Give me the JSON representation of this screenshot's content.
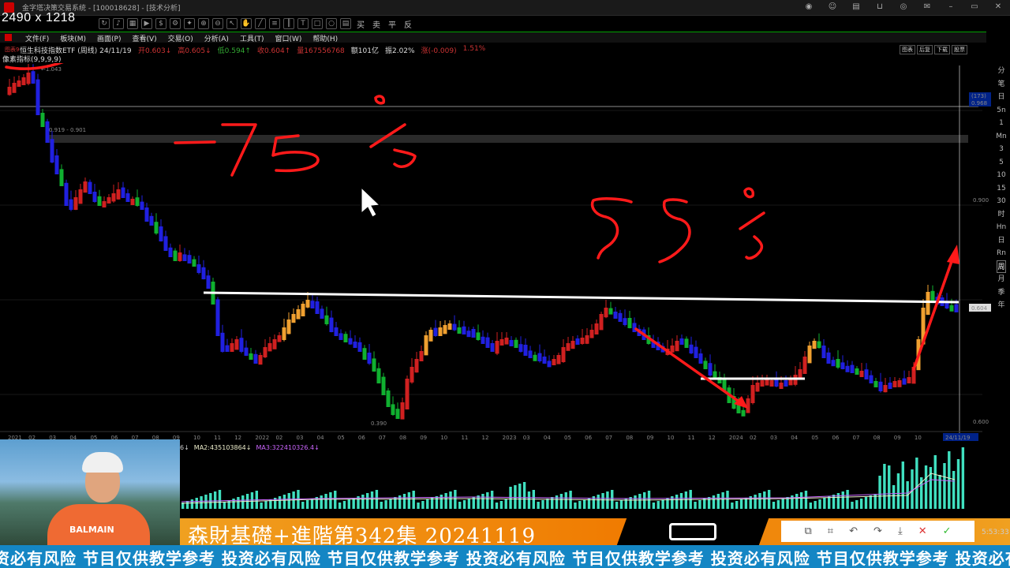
{
  "window": {
    "title": "金字塔决策交易系统 - [100018628] - [技术分析]",
    "dims_overlay": "2490 x 1218",
    "toolbar_trade_labels": [
      "买",
      "卖",
      "平",
      "反"
    ]
  },
  "menu": {
    "items": [
      "文件(F)",
      "板块(M)",
      "画面(P)",
      "查看(V)",
      "交易(O)",
      "分析(A)",
      "工具(T)",
      "窗口(W)",
      "帮助(H)"
    ]
  },
  "chart_header": {
    "tag": "图表9",
    "name": "恒生科技指数ETF (周线)",
    "date": "24/11/19",
    "open": "开0.603↓",
    "high": "高0.605↓",
    "low": "低0.594↑",
    "close": "收0.604↑",
    "volume": "量167556768",
    "amount": "额101亿",
    "amplitude": "振2.02%",
    "change": "涨(-0.009)",
    "change_pct": "1.51%",
    "buttons": [
      "图表",
      "后复",
      "下载",
      "股票"
    ]
  },
  "indicator_label": "像素指标(9,9,9,9)",
  "chart_data": {
    "type": "candlestick",
    "timeframe": "weekly",
    "instrument": "恒生科技指数ETF",
    "price_labels": {
      "top_high": "1.043",
      "resistance_zone": "0.919 - 0.901",
      "low_marker": "0.390",
      "current_price": "0.604",
      "crosshair_value": "0.968",
      "crosshair_count": "(173)",
      "right_axis_ticks": [
        "0.900",
        "0.600"
      ]
    },
    "x_ticks": [
      "2021",
      "02",
      "03",
      "04",
      "05",
      "06",
      "07",
      "08",
      "09",
      "10",
      "11",
      "12",
      "2022",
      "02",
      "03",
      "04",
      "05",
      "06",
      "07",
      "08",
      "09",
      "10",
      "11",
      "12",
      "2023",
      "03",
      "04",
      "05",
      "06",
      "07",
      "08",
      "09",
      "10",
      "11",
      "12",
      "2024",
      "02",
      "03",
      "04",
      "05",
      "06",
      "07",
      "08",
      "09",
      "10",
      "24/11/19"
    ],
    "annotations": {
      "handwritten_left": "75%",
      "handwritten_right": "55%"
    }
  },
  "volume": {
    "ma2": "MA2:435103864↓",
    "ma3": "MA3:322410326.4↓",
    "ma1_tail": "6↓"
  },
  "right_panel": {
    "items": [
      "分",
      "笔",
      "日",
      "5n",
      "1",
      "Mn",
      "3",
      "5",
      "10",
      "15",
      "30",
      "时",
      "Hn",
      "日",
      "Rn",
      "周",
      "月",
      "季",
      "年"
    ],
    "active": "周"
  },
  "banner": {
    "title": "森財基礎+進階第342集 20241119"
  },
  "clock": "5:53:33",
  "ticker": {
    "text": "资必有风险 节目仅供教学参考 投资必有风险 节目仅供教学参考 投资必有风险 节目仅供教学参考 投资必有风险 节目仅供教学参考 投资必有风险"
  },
  "webcam": {
    "shirt_text": "BALMAIN"
  },
  "colors": {
    "up": "#d02020",
    "down": "#2020e0",
    "down_green": "#10b030",
    "orange": "#f0a030",
    "resistance_line": "#ffffff",
    "annotation": "#ff1a1a",
    "volume_bar": "#40e0c0"
  }
}
